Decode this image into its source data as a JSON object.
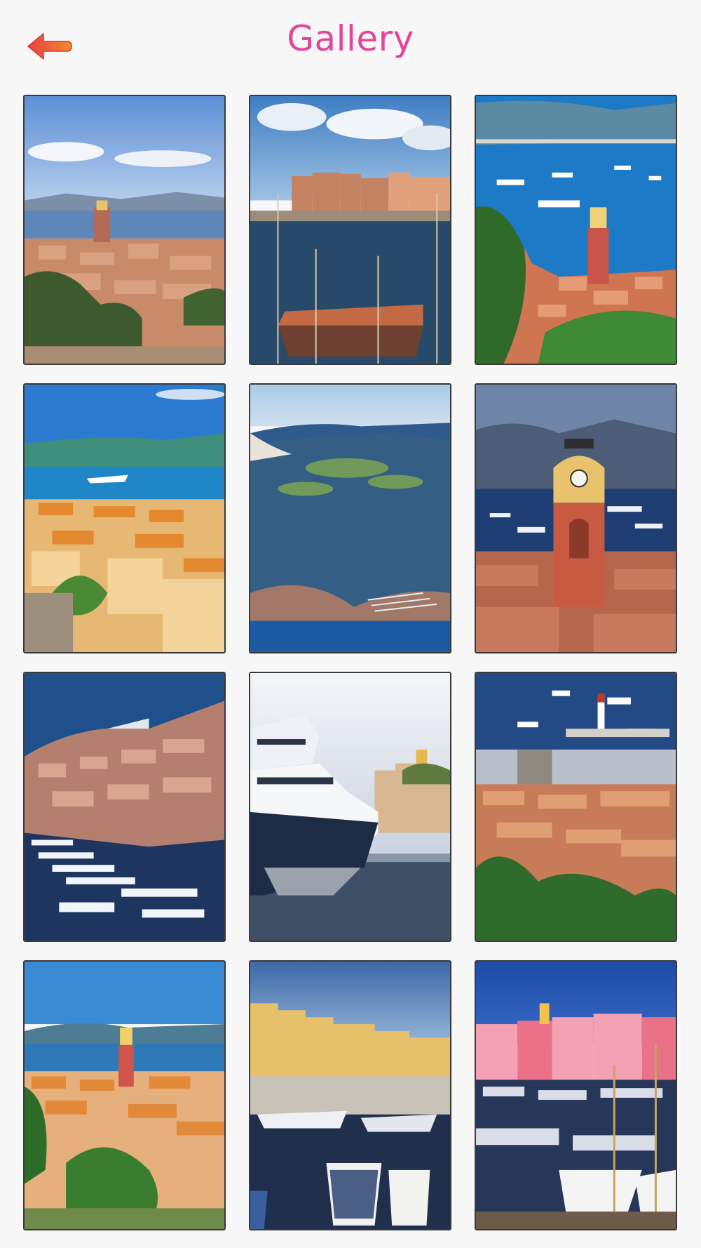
{
  "header": {
    "title": "Gallery",
    "back_icon": "arrow-left-icon",
    "title_color": "#e3459b",
    "back_icon_colors": [
      "#f58a2e",
      "#e8413f"
    ]
  },
  "gallery": {
    "items": [
      {
        "scene": "hilltop-town-bay"
      },
      {
        "scene": "harbor-sailboats"
      },
      {
        "scene": "aerial-bay-clocktower"
      },
      {
        "scene": "coastal-rooftops-yacht"
      },
      {
        "scene": "aerial-peninsula"
      },
      {
        "scene": "clocktower-closeup"
      },
      {
        "scene": "aerial-town-marina"
      },
      {
        "scene": "superyacht-bow"
      },
      {
        "scene": "lighthouse-harbor"
      },
      {
        "scene": "bell-tower-village"
      },
      {
        "scene": "quayside-boats"
      },
      {
        "scene": "harbor-at-dusk"
      }
    ]
  }
}
